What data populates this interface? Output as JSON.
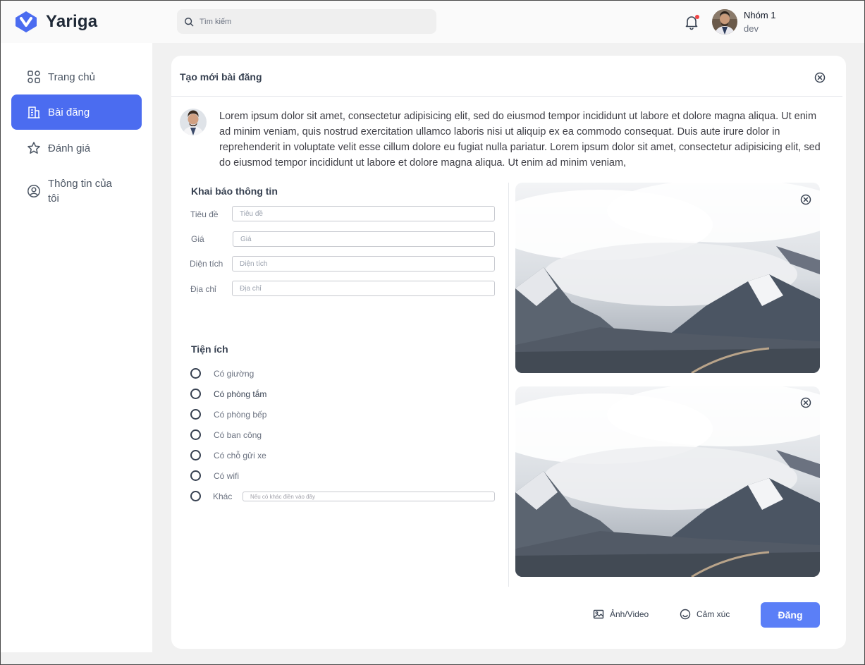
{
  "app": {
    "name": "Yariga"
  },
  "search": {
    "placeholder": "Tìm kiếm"
  },
  "user": {
    "name": "Nhóm 1",
    "role": "dev"
  },
  "sidebar": {
    "items": [
      {
        "label": "Trang chủ",
        "icon": "grid-icon",
        "active": false
      },
      {
        "label": "Bài đăng",
        "icon": "building-icon",
        "active": true
      },
      {
        "label": "Đánh giá",
        "icon": "star-icon",
        "active": false
      },
      {
        "label": "Thông tin của tôi",
        "icon": "user-circle-icon",
        "active": false
      }
    ]
  },
  "dialog": {
    "title": "Tạo mới bài đăng",
    "post_text": "Lorem ipsum dolor sit amet, consectetur adipisicing elit, sed do eiusmod tempor incididunt ut labore et dolore magna aliqua. Ut enim ad minim veniam, quis nostrud exercitation ullamco laboris nisi ut aliquip ex ea commodo consequat. Duis aute irure dolor in reprehenderit in voluptate velit esse cillum dolore eu fugiat nulla pariatur.  Lorem ipsum dolor sit amet, consectetur adipisicing elit, sed do eiusmod tempor incididunt ut labore et dolore magna aliqua. Ut enim ad minim veniam,"
  },
  "info_form": {
    "title": "Khai báo thông tin",
    "fields": [
      {
        "label": "Tiêu đề",
        "placeholder": "Tiêu đề"
      },
      {
        "label": "Giá",
        "placeholder": "Giá"
      },
      {
        "label": "Diện tích",
        "placeholder": "Diện tích"
      },
      {
        "label": "Địa chỉ",
        "placeholder": "Địa chỉ"
      }
    ]
  },
  "amenities": {
    "title": "Tiện ích",
    "items": [
      {
        "label": "Có giường"
      },
      {
        "label": "Có phòng tắm"
      },
      {
        "label": "Có phòng bếp"
      },
      {
        "label": "Có ban công"
      },
      {
        "label": "Có chỗ gửi xe"
      },
      {
        "label": "Có wifi"
      },
      {
        "label": "Khác"
      }
    ],
    "other_placeholder": "Nếu có khác điền vào đây"
  },
  "actions": {
    "media_label": "Ảnh/Video",
    "emotion_label": "Cảm xúc",
    "submit_label": "Đăng"
  },
  "colors": {
    "accent": "#4b6cf0",
    "submit": "#5b7ff7",
    "notification_dot": "#ef4444"
  }
}
